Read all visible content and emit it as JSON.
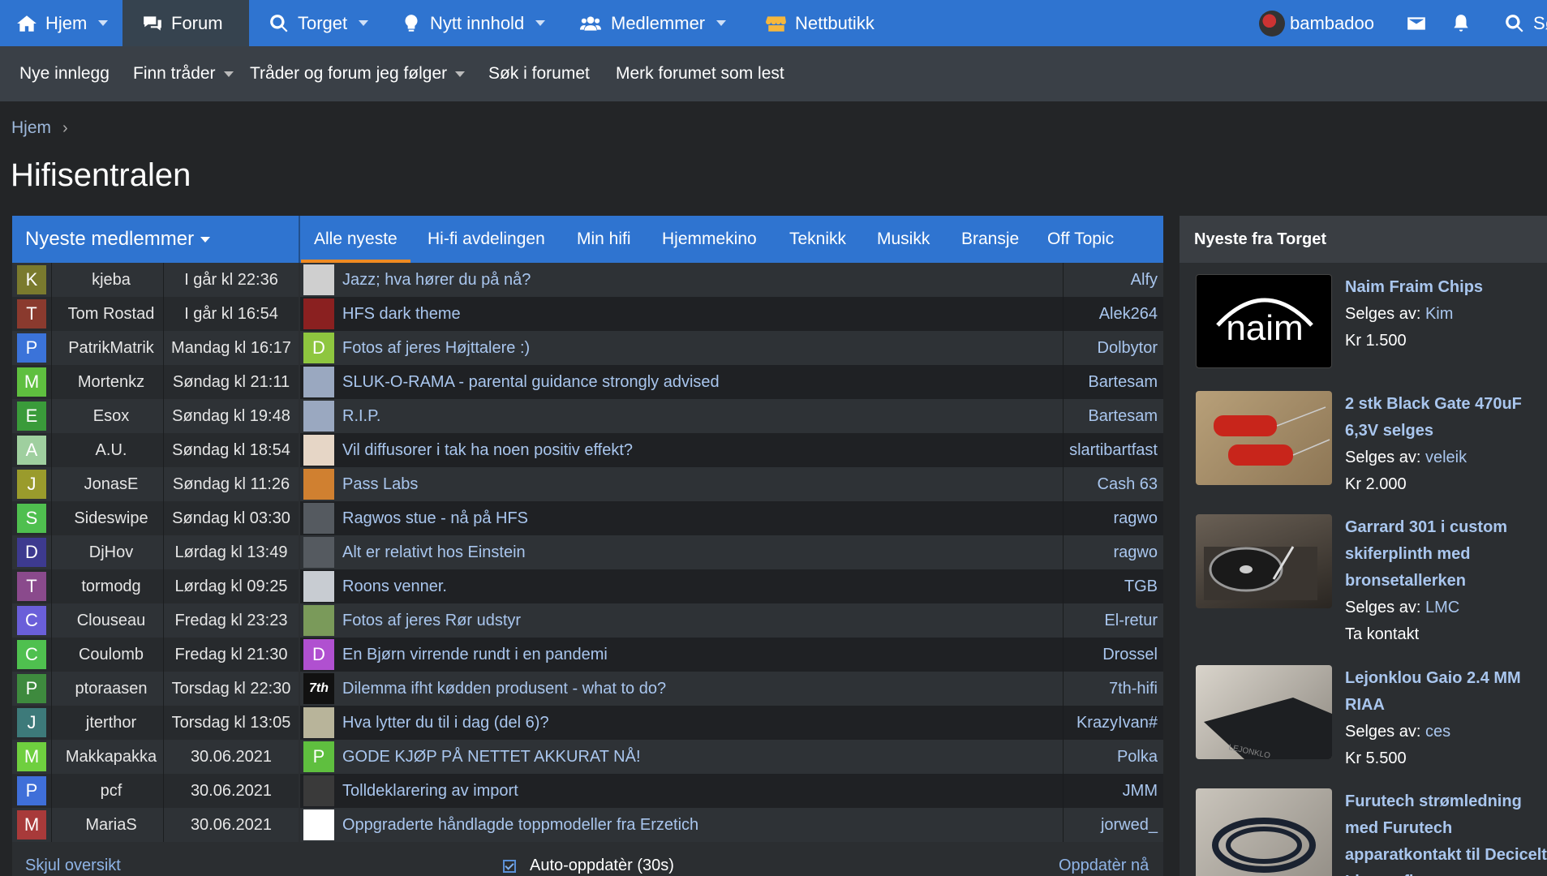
{
  "nav": {
    "home": "Hjem",
    "forum": "Forum",
    "market": "Torget",
    "new_content": "Nytt innhold",
    "members": "Medlemmer",
    "shop": "Nettbutikk",
    "username": "bambadoo",
    "search": "Sø"
  },
  "subnav": {
    "new_posts": "Nye innlegg",
    "find_threads": "Finn tråder",
    "watched": "Tråder og forum jeg følger",
    "search_forums": "Søk i forumet",
    "mark_read": "Merk forumet som lest"
  },
  "breadcrumb": {
    "home": "Hjem"
  },
  "page_title": "Hifisentralen",
  "members_panel": {
    "title": "Nyeste medlemmer",
    "rows": [
      {
        "initial": "K",
        "name": "kjeba",
        "date": "I går kl 22:36",
        "color": "#7a7a2e"
      },
      {
        "initial": "T",
        "name": "Tom Rostad",
        "date": "I går kl 16:54",
        "color": "#8a3a2e"
      },
      {
        "initial": "P",
        "name": "PatrikMatrik",
        "date": "Mandag kl 16:17",
        "color": "#3b73d9"
      },
      {
        "initial": "M",
        "name": "Mortenkz",
        "date": "Søndag kl 21:11",
        "color": "#5fbf3f"
      },
      {
        "initial": "E",
        "name": "Esox",
        "date": "Søndag kl 19:48",
        "color": "#3a9b3a"
      },
      {
        "initial": "A",
        "name": "A.U.",
        "date": "Søndag kl 18:54",
        "color": "#9fcf9f"
      },
      {
        "initial": "J",
        "name": "JonasE",
        "date": "Søndag kl 11:26",
        "color": "#9a9b2c"
      },
      {
        "initial": "S",
        "name": "Sideswipe",
        "date": "Søndag kl 03:30",
        "color": "#4fbf4f"
      },
      {
        "initial": "D",
        "name": "DjHov",
        "date": "Lørdag kl 13:49",
        "color": "#3d3a8f"
      },
      {
        "initial": "T",
        "name": "tormodg",
        "date": "Lørdag kl 09:25",
        "color": "#8a4a8c"
      },
      {
        "initial": "C",
        "name": "Clouseau",
        "date": "Fredag kl 23:23",
        "color": "#6a5fd9"
      },
      {
        "initial": "C",
        "name": "Coulomb",
        "date": "Fredag kl 21:30",
        "color": "#4fc04f"
      },
      {
        "initial": "P",
        "name": "ptoraasen",
        "date": "Torsdag kl 22:30",
        "color": "#3e8a3e"
      },
      {
        "initial": "J",
        "name": "jterthor",
        "date": "Torsdag kl 13:05",
        "color": "#3d7a7a"
      },
      {
        "initial": "M",
        "name": "Makkapakka",
        "date": "30.06.2021",
        "color": "#6fcf3f"
      },
      {
        "initial": "P",
        "name": "pcf",
        "date": "30.06.2021",
        "color": "#3f6fd9"
      },
      {
        "initial": "M",
        "name": "MariaS",
        "date": "30.06.2021",
        "color": "#a83a3a"
      }
    ]
  },
  "tabs": [
    "Alle nyeste",
    "Hi-fi avdelingen",
    "Min hifi",
    "Hjemmekino",
    "Teknikk",
    "Musikk",
    "Bransje",
    "Off Topic"
  ],
  "threads": [
    {
      "title": "Jazz; hva hører du på nå?",
      "user": "Alfy",
      "thumb": "#cfcfcf",
      "letter": ""
    },
    {
      "title": "HFS dark theme",
      "user": "Alek264",
      "thumb": "#8a2020",
      "letter": ""
    },
    {
      "title": "Fotos af jeres Højttalere :)",
      "user": "Dolbytor",
      "thumb": "#8ec63f",
      "letter": "D"
    },
    {
      "title": "SLUK-O-RAMA - parental guidance strongly advised",
      "user": "Bartesam",
      "thumb": "#9aa8c0",
      "letter": ""
    },
    {
      "title": "R.I.P.",
      "user": "Bartesam",
      "thumb": "#9aa8c0",
      "letter": ""
    },
    {
      "title": "Vil diffusorer i tak ha noen positiv effekt?",
      "user": "slartibartfast",
      "thumb": "#e6d6c6",
      "letter": ""
    },
    {
      "title": "Pass Labs",
      "user": "Cash 63",
      "thumb": "#d08030",
      "letter": ""
    },
    {
      "title": "Ragwos stue - nå på HFS",
      "user": "ragwo",
      "thumb": "#555a60",
      "letter": ""
    },
    {
      "title": "Alt er relativt hos Einstein",
      "user": "ragwo",
      "thumb": "#555a60",
      "letter": ""
    },
    {
      "title": "Roons venner.",
      "user": "TGB",
      "thumb": "#c8ccd2",
      "letter": ""
    },
    {
      "title": "Fotos af jeres Rør udstyr",
      "user": "El-retur",
      "thumb": "#7a9a5a",
      "letter": ""
    },
    {
      "title": "En Bjørn virrende rundt i en pandemi",
      "user": "Drossel",
      "thumb": "#b050d0",
      "letter": "D"
    },
    {
      "title": "Dilemma ifht kødden produsent - what to do?",
      "user": "7th-hifi",
      "thumb": "#111111",
      "letter": "7th"
    },
    {
      "title": "Hva lytter du til i dag (del 6)?",
      "user": "KrazyIvan#",
      "thumb": "#b8b49a",
      "letter": ""
    },
    {
      "title": "GODE KJØP PÅ NETTET AKKURAT NÅ!",
      "user": "Polka",
      "thumb": "#5fbf3f",
      "letter": "P"
    },
    {
      "title": "Tolldeklarering av import",
      "user": "JMM",
      "thumb": "#3a3a3a",
      "letter": ""
    },
    {
      "title": "Oppgraderte håndlagde toppmodeller fra Erzetich",
      "user": "jorwed_",
      "thumb": "#ffffff",
      "letter": ""
    }
  ],
  "footer": {
    "hide": "Skjul oversikt",
    "auto": "Auto-oppdatèr (30s)",
    "refresh": "Oppdatèr nå"
  },
  "market_panel": {
    "title": "Nyeste fra Torget",
    "sold_by": "Selges av:",
    "items": [
      {
        "title": "Naim Fraim Chips",
        "seller": "Kim",
        "price": "Kr 1.500",
        "extra": ""
      },
      {
        "title": "2 stk Black Gate 470uF 6,3V selges",
        "seller": "veleik",
        "price": "Kr 2.000",
        "extra": ""
      },
      {
        "title": "Garrard 301 i custom skiferplinth med bronsetallerken",
        "seller": "LMC",
        "price": "",
        "extra": "Ta kontakt"
      },
      {
        "title": "Lejonklou Gaio 2.4 MM RIAA",
        "seller": "ces",
        "price": "Kr 5.500",
        "extra": ""
      },
      {
        "title": "Furutech strømledning med Furutech apparatkontakt til Decicelt Lignon fl...",
        "seller": "",
        "price": "",
        "extra": ""
      }
    ],
    "naim_logo": "naim",
    "lejonklou_logo": "LEJONKLO"
  }
}
